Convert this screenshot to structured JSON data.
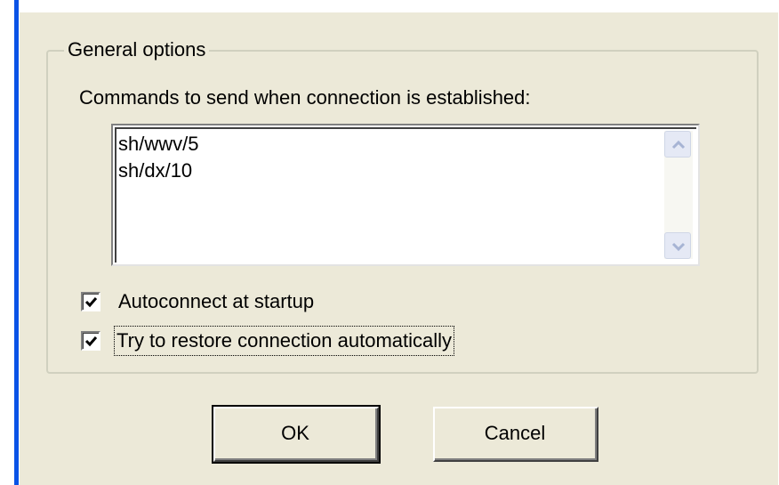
{
  "group": {
    "label": "General options",
    "commands_label": "Commands to send when connection is established:",
    "commands_text": "sh/wwv/5\nsh/dx/10"
  },
  "options": {
    "autoconnect": {
      "label": "Autoconnect at startup",
      "checked": true
    },
    "restore": {
      "label": "Try to restore connection automatically",
      "checked": true,
      "focused": true
    }
  },
  "buttons": {
    "ok_label": "OK",
    "cancel_label": "Cancel"
  },
  "scrollbar": {
    "up_icon": "scroll-up-arrow",
    "down_icon": "scroll-down-arrow"
  },
  "colors": {
    "dialog_bg": "#ece9d8",
    "accent_border": "#0a53e6"
  }
}
